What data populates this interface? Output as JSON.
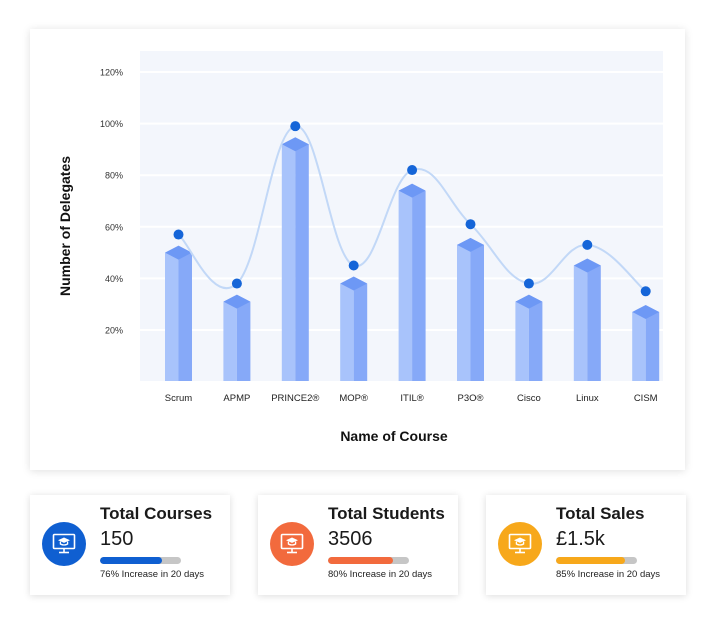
{
  "chart_data": {
    "type": "bar",
    "xlabel": "Name of Course",
    "ylabel": "Number of Delegates",
    "ylim": [
      0,
      120
    ],
    "yticks": [
      20,
      40,
      60,
      80,
      100,
      120
    ],
    "ytick_labels": [
      "20%",
      "40%",
      "60%",
      "80%",
      "100%",
      "120%"
    ],
    "categories": [
      "Scrum",
      "APMP",
      "PRINCE2®",
      "MOP®",
      "ITIL®",
      "P3O®",
      "Cisco",
      "Linux",
      "CISM"
    ],
    "series": [
      {
        "values": [
          50,
          31,
          92,
          38,
          74,
          53,
          31,
          45,
          27
        ]
      },
      {
        "values": [
          57,
          38,
          99,
          45,
          82,
          61,
          38,
          53,
          35
        ]
      }
    ],
    "grid": true,
    "colors": {
      "bar": "#a8c3fb",
      "bar_top": "#6d98f5",
      "bar_side": "#86a9f8",
      "point": "#1565d8",
      "curve": "#c2d8f7",
      "plot_bg": "#f3f6fc"
    }
  },
  "stats": [
    {
      "title": "Total Courses",
      "value": "150",
      "note": "76% Increase in 20 days",
      "progress": 0.76,
      "color": "#0f5fd1",
      "icon": "monitor-graduation-icon"
    },
    {
      "title": "Total Students",
      "value": "3506",
      "note": "80% Increase in 20 days",
      "progress": 0.8,
      "color": "#f26a3d",
      "icon": "monitor-graduation-icon"
    },
    {
      "title": "Total Sales",
      "value": "£1.5k",
      "note": "85% Increase in 20 days",
      "progress": 0.85,
      "color": "#f7a81b",
      "icon": "monitor-graduation-icon"
    }
  ]
}
